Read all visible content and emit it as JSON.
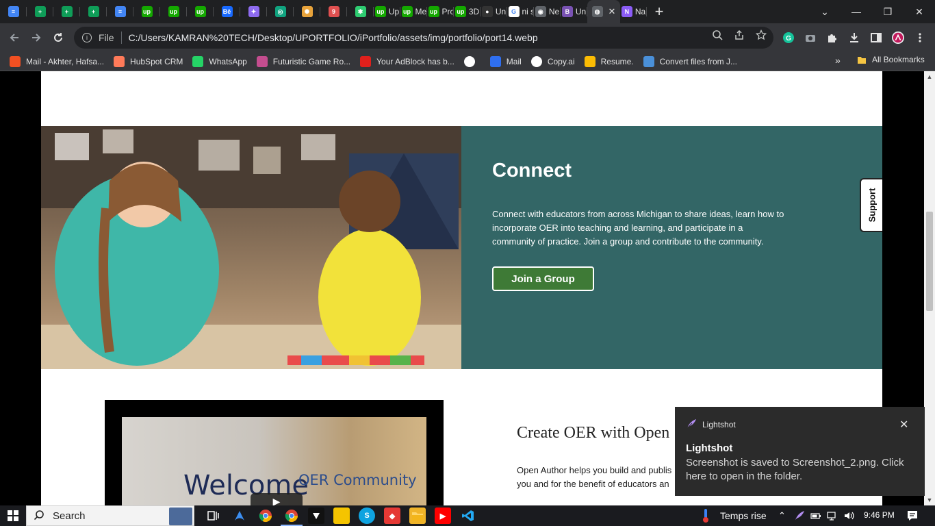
{
  "browser": {
    "tabs": [
      {
        "icon": "docs-icon",
        "label": "",
        "color": "#4285f4"
      },
      {
        "icon": "sheets-icon",
        "label": "",
        "color": "#0f9d58"
      },
      {
        "icon": "sheets-icon",
        "label": "",
        "color": "#0f9d58"
      },
      {
        "icon": "sheets-icon",
        "label": "",
        "color": "#0f9d58"
      },
      {
        "icon": "docs-icon",
        "label": "",
        "color": "#4285f4"
      },
      {
        "icon": "upwork-icon",
        "label": "",
        "color": "#14a800"
      },
      {
        "icon": "upwork-icon",
        "label": "",
        "color": "#14a800"
      },
      {
        "icon": "upwork-icon",
        "label": "",
        "color": "#14a800"
      },
      {
        "icon": "behance-icon",
        "label": "",
        "color": "#1769ff"
      },
      {
        "icon": "gemini-icon",
        "label": "",
        "color": "#8e6bf0"
      },
      {
        "icon": "chatgpt-icon",
        "label": "",
        "color": "#10a37f"
      },
      {
        "icon": "pinwheel-icon",
        "label": "",
        "color": "#e8a33b"
      },
      {
        "icon": "image-icon",
        "label": "",
        "color": "#e05050"
      },
      {
        "icon": "asterisk-icon",
        "label": "",
        "color": "#2ecc71"
      },
      {
        "icon": "upwork-icon",
        "label": "Up",
        "color": "#14a800"
      },
      {
        "icon": "upwork-icon",
        "label": "Me",
        "color": "#14a800"
      },
      {
        "icon": "upwork-icon",
        "label": "Pro",
        "color": "#14a800"
      },
      {
        "icon": "upwork-icon",
        "label": "3D",
        "color": "#14a800"
      },
      {
        "icon": "github-icon",
        "label": "Un",
        "color": "#333333"
      },
      {
        "icon": "google-icon",
        "label": "ni s",
        "color": "#ffffff"
      },
      {
        "icon": "chrome-icon",
        "label": "Ne",
        "color": "#5f6368"
      },
      {
        "icon": "bootstrap-icon",
        "label": "Un",
        "color": "#7952b3"
      },
      {
        "icon": "globe-icon",
        "label": "",
        "color": "#5f6368"
      },
      {
        "icon": "canva-icon",
        "label": "Na",
        "color": "#8b5cf6"
      }
    ],
    "active_tab_index": 22,
    "new_tab": "+",
    "window_controls": {
      "minimize": "—",
      "maximize": "❐",
      "close": "✕",
      "dropdown": "⌄"
    },
    "address": {
      "scheme": "File",
      "url": "C:/Users/KAMRAN%20TECH/Desktop/UPORTFOLIO/iPortfolio/assets/img/portfolio/port14.webp"
    },
    "bookmarks": [
      {
        "label": "Mail - Akhter, Hafsa...",
        "icon": "microsoft-icon",
        "color": "#f25022"
      },
      {
        "label": "HubSpot CRM",
        "icon": "hubspot-icon",
        "color": "#ff7a59"
      },
      {
        "label": "WhatsApp",
        "icon": "whatsapp-icon",
        "color": "#25d366"
      },
      {
        "label": "Futuristic Game Ro...",
        "icon": "game-icon",
        "color": "#c44d8f"
      },
      {
        "label": "Your AdBlock has b...",
        "icon": "adblock-icon",
        "color": "#e0201c"
      },
      {
        "label": "",
        "icon": "globe-icon",
        "color": "#ffffff"
      },
      {
        "label": "Mail",
        "icon": "mail-icon",
        "color": "#2f6ff0"
      },
      {
        "label": "Copy.ai",
        "icon": "copyai-icon",
        "color": "#ffffff"
      },
      {
        "label": "Resume.",
        "icon": "drive-icon",
        "color": "#fbbc04"
      },
      {
        "label": "Convert files from J...",
        "icon": "convert-icon",
        "color": "#4a90d9"
      }
    ],
    "bookmarks_overflow": "»",
    "all_bookmarks": "All Bookmarks"
  },
  "page": {
    "connect": {
      "title": "Connect",
      "body": "Connect with educators from across Michigan to share ideas, learn how to incorporate OER into teaching and learning, and participate in a community of practice. Join a group and contribute to the community.",
      "button": "Join a Group",
      "panel_color": "#336666",
      "button_color": "#3e7a36"
    },
    "support_tab": "Support",
    "video": {
      "welcome": "Welcome",
      "oer": "OER Community",
      "play": "▶"
    },
    "create": {
      "title": "Create OER with Open",
      "body_line1": "Open Author helps you build and publis",
      "body_line2": "you and for the benefit of educators an"
    }
  },
  "notification": {
    "app": "Lightshot",
    "title": "Lightshot",
    "body": "Screenshot is saved to Screenshot_2.png. Click here to open in the folder.",
    "close": "✕"
  },
  "taskbar": {
    "search_label": "Search",
    "weather": "Temps rise",
    "time": "9:46 PM"
  }
}
